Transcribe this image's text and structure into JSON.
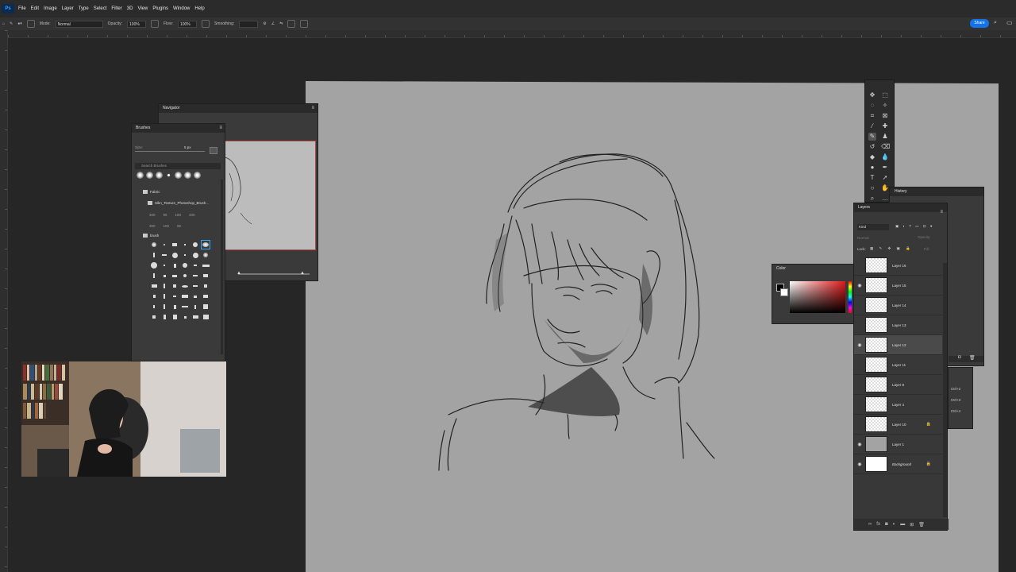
{
  "app": {
    "logo": "Ps"
  },
  "menu": [
    "File",
    "Edit",
    "Image",
    "Layer",
    "Type",
    "Select",
    "Filter",
    "3D",
    "View",
    "Plugins",
    "Window",
    "Help"
  ],
  "options": {
    "mode_label": "Mode:",
    "mode_value": "Normal",
    "opacity_label": "Opacity:",
    "opacity_value": "100%",
    "flow_label": "Flow:",
    "flow_value": "100%",
    "smoothing_label": "Smoothing:",
    "share_label": "Share"
  },
  "navigator": {
    "title": "Navigator"
  },
  "brushes": {
    "title": "Brushes",
    "size_label": "Size:",
    "size_value": "5 px",
    "search_placeholder": "Search Brushes",
    "folders": [
      "Fabric",
      "Sikn_Texture_Photoshop_Brush...",
      "brush"
    ],
    "size_numbers_row1": [
      "300",
      "95",
      "180",
      "200"
    ],
    "size_numbers_row2": [
      "300",
      "100",
      "96"
    ]
  },
  "color": {
    "title": "Color",
    "accent": "#e11919"
  },
  "history": {
    "title": "History"
  },
  "layers": {
    "title": "Layers",
    "kind_label": "Kind",
    "blend_label": "Normal",
    "opacity_label": "Opacity:",
    "lock_label": "Lock:",
    "fill_label": "Fill:",
    "items": [
      {
        "name": "Layer 16",
        "visible": false,
        "thumb": "transparent",
        "locked": false,
        "selected": false
      },
      {
        "name": "Layer 15",
        "visible": true,
        "thumb": "transparent",
        "locked": false,
        "selected": false
      },
      {
        "name": "Layer 14",
        "visible": false,
        "thumb": "transparent",
        "locked": false,
        "selected": false
      },
      {
        "name": "Layer 13",
        "visible": false,
        "thumb": "transparent",
        "locked": false,
        "selected": false
      },
      {
        "name": "Layer 12",
        "visible": true,
        "thumb": "transparent",
        "locked": false,
        "selected": true
      },
      {
        "name": "Layer 11",
        "visible": false,
        "thumb": "transparent",
        "locked": false,
        "selected": false
      },
      {
        "name": "Layer 8",
        "visible": false,
        "thumb": "transparent",
        "locked": false,
        "selected": false
      },
      {
        "name": "Layer 4",
        "visible": false,
        "thumb": "transparent",
        "locked": false,
        "selected": false
      },
      {
        "name": "Layer 10",
        "visible": false,
        "thumb": "transparent",
        "locked": true,
        "selected": false
      },
      {
        "name": "Layer 1",
        "visible": true,
        "thumb": "gray",
        "locked": false,
        "selected": false
      },
      {
        "name": "Background",
        "visible": true,
        "thumb": "white",
        "locked": true,
        "selected": false
      }
    ]
  },
  "shortcuts": [
    "Ctrl+2",
    "Ctrl+3",
    "Ctrl+4"
  ]
}
